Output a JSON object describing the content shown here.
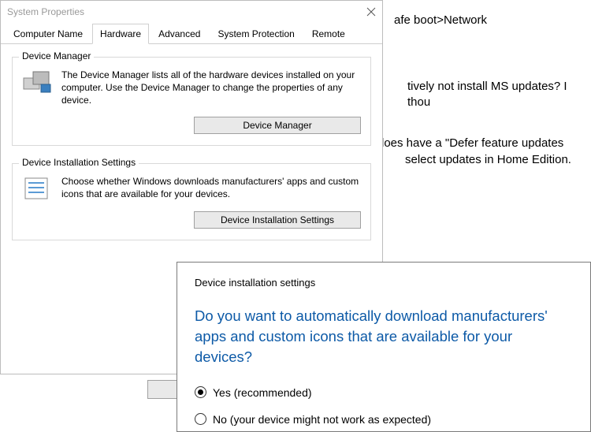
{
  "bg": {
    "line1": "afe boot>Network",
    "line2": "tively not install MS updates? I thou",
    "line3": "loes have a \"Defer feature updates",
    "line4": "select updates in Home Edition."
  },
  "win": {
    "title": "System Properties",
    "tabs": [
      "Computer Name",
      "Hardware",
      "Advanced",
      "System Protection",
      "Remote"
    ],
    "group1": {
      "legend": "Device Manager",
      "desc": "The Device Manager lists all of the hardware devices installed on your computer. Use the Device Manager to change the properties of any device.",
      "btn": "Device Manager"
    },
    "group2": {
      "legend": "Device Installation Settings",
      "desc": "Choose whether Windows downloads manufacturers' apps and custom icons that are available for your devices.",
      "btn": "Device Installation Settings"
    }
  },
  "dlg": {
    "title": "Device installation settings",
    "question": "Do you want to automatically download manufacturers' apps and custom icons that are available for your devices?",
    "opt1": "Yes (recommended)",
    "opt2": "No (your device might not work as expected)"
  }
}
